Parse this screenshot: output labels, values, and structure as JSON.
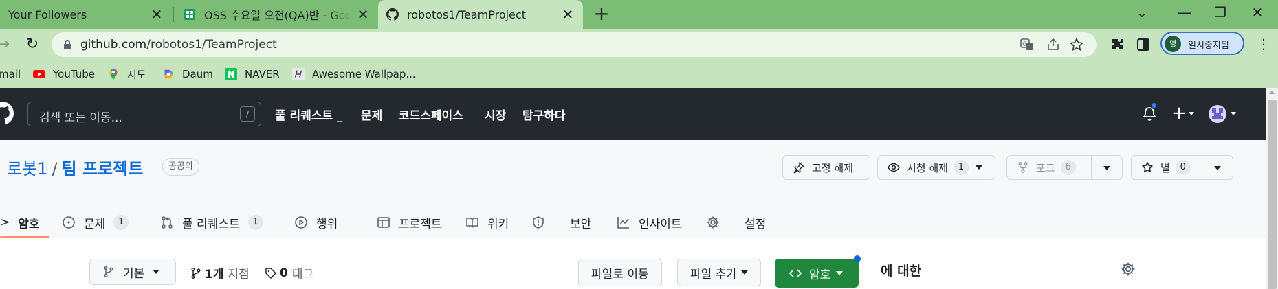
{
  "browser": {
    "tabs": [
      {
        "title": "Your Followers",
        "close": "✕"
      },
      {
        "title": "OSS 수요일 오전(QA)반 - Googl",
        "close": "✕"
      },
      {
        "title": "robotos1/TeamProject",
        "close": "✕"
      }
    ],
    "new_tab": "+",
    "window_controls": {
      "minimize": "—",
      "restore": "❐",
      "close": "✕",
      "tab_search": "⌄"
    },
    "nav": {
      "back": "→",
      "reload": "↻"
    },
    "url": {
      "host": "github.com",
      "path": "/robotos1/TeamProject"
    },
    "profile": {
      "initial": "멍",
      "label": "일시중지됨"
    },
    "menu": "⋮",
    "bookmarks": [
      {
        "label": "mail"
      },
      {
        "label": "YouTube"
      },
      {
        "label": "지도"
      },
      {
        "label": "Daum"
      },
      {
        "label": "NAVER"
      },
      {
        "label": "Awesome Wallpap..."
      }
    ]
  },
  "github": {
    "search_placeholder": "검색 또는 이동...",
    "search_shortcut": "/",
    "nav": [
      "풀 리퀘스트 _",
      "문제",
      "코드스페이스",
      "시장",
      "탐구하다"
    ],
    "plus": "+"
  },
  "repo": {
    "owner": "로봇1",
    "separator": "/",
    "name": "팀 프로젝트",
    "visibility": "공공의",
    "actions": {
      "pin": {
        "label": "고정 해제"
      },
      "watch": {
        "label": "시청 해제",
        "count": "1"
      },
      "fork": {
        "label": "포크",
        "count": "6"
      },
      "star": {
        "label": "별",
        "count": "0"
      }
    },
    "tabs": [
      {
        "label": "암호",
        "count": null
      },
      {
        "label": "문제",
        "count": "1"
      },
      {
        "label": "풀 리퀘스트",
        "count": "1"
      },
      {
        "label": "행위",
        "count": null
      },
      {
        "label": "프로젝트",
        "count": null
      },
      {
        "label": "위키",
        "count": null
      },
      {
        "label": "보안",
        "count": null
      },
      {
        "label": "인사이트",
        "count": null
      },
      {
        "label": "설정",
        "count": null
      }
    ],
    "tab_prefix": ">",
    "body": {
      "branch_label": "기본",
      "branches_count": "1개",
      "branches_label": "지점",
      "tags_count": "0",
      "tags_label": "태그",
      "goto_file": "파일로 이동",
      "add_file": "파일 추가",
      "code": "암호",
      "about": "에 대한"
    }
  },
  "colors": {
    "tabstrip": "#7cbd76",
    "toolbar": "#c6e4bd",
    "gh_header": "#24292f",
    "link": "#0969da",
    "green_button": "#1f883d",
    "tab_underline": "#fd8c73"
  }
}
